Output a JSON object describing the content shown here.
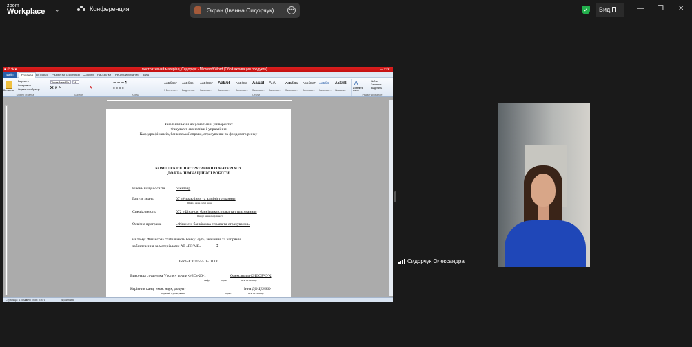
{
  "app": {
    "logo_line1": "zoom",
    "logo_line2": "Workplace",
    "meeting_label": "Конференция"
  },
  "share_tab": {
    "label": "Экран (Іванна Сидорчук)"
  },
  "header_right": {
    "view_label": "Вид"
  },
  "word": {
    "title": "Ілюстративний матеріал_Сидорчук - Microsoft Word (Сбой активации продукта)",
    "tabs": [
      "Файл",
      "Главная",
      "Вставка",
      "Разметка страницы",
      "Ссылки",
      "Рассылки",
      "Рецензирование",
      "Вид"
    ],
    "clipboard": {
      "paste": "Вставить",
      "cut": "Вырезать",
      "copy": "Копировать",
      "format": "Формат по образцу"
    },
    "font_name": "Times New Ro",
    "font_size": "14",
    "group_labels": [
      "Буфер обмена",
      "Шрифт",
      "Абзац",
      "Стили",
      "Редактирование"
    ],
    "styles": [
      {
        "sample": "АаБбВвГ",
        "label": "1 Без инте..."
      },
      {
        "sample": "АаБбВв",
        "label": "Выделение"
      },
      {
        "sample": "АаБбВвГ",
        "label": "Заголово..."
      },
      {
        "sample": "АаБбІ",
        "label": "Заголово..."
      },
      {
        "sample": "АаБбВв",
        "label": "Заголово..."
      },
      {
        "sample": "АаБбІ",
        "label": "Заголово..."
      },
      {
        "sample": "А А",
        "label": "Заголово..."
      },
      {
        "sample": "АаБбВв",
        "label": "Заголово..."
      },
      {
        "sample": "АаБбВвГ",
        "label": "Заголово..."
      },
      {
        "sample": "АаБбВ",
        "label": "Заголово..."
      },
      {
        "sample": "АаБбВ",
        "label": "Название"
      }
    ],
    "change_styles": "Изменить стили",
    "editing": {
      "find": "Найти",
      "replace": "Заменить",
      "select": "Выделить"
    },
    "status": {
      "page": "Страница: 1 из 24",
      "words": "Число слов: 3 871",
      "lang": "украинский"
    }
  },
  "doc": {
    "uni": "Хмельницький національний університет",
    "faculty": "Факультет економіки і управління",
    "dept": "Кафедра фінансів, банківської справи, страхування та фондового ринку",
    "title1": "КОМПЛЕКТ ІЛЮСТРАТИВНОГО МАТЕРІАЛУ",
    "title2": "ДО  КВАЛІФІКАЦІЙНОЇ РОБОТИ",
    "level_lbl": "Рівень вищої освіти",
    "level_val": "бакалавр",
    "field_lbl": "Галузь знань",
    "field_val": "07 «Управління та адміністрування»",
    "field_hint": "Шифр і назва галузі знань",
    "spec_lbl": "Спеціальність",
    "spec_val": "072 «Фінанси, банківська справа та страхування»",
    "spec_hint": "Шифр і назва спеціальності",
    "prog_lbl": "Освітня програма",
    "prog_val": "«Фінанси, банківська справа та страхування»",
    "topic1": "на  тему:  Фінансова  стабільність  банку:  суть,  значення  та  напрями",
    "topic2": "забезпечення за матеріалами АТ «ПУМБ»",
    "code": "ІМФБС.071555.05.01.00",
    "student": "Виконала студентка V курсу групи ФБСз-20-1",
    "student_name": "Олександра СИДОРЧУК",
    "sig_hints": [
      "шифр",
      "Підпис",
      "Ім'я, ПРІЗВИЩЕ"
    ],
    "supervisor": "Керівник канд. екон. наук, доцент",
    "supervisor_name": "Інна ДОЦЕНКО",
    "sup_hints": [
      "Науковий ступінь, звання",
      "Підпис",
      "Ім'я, ПРІЗВИЩЕ"
    ]
  },
  "participant": {
    "name": "Сидорчук Олександра"
  }
}
